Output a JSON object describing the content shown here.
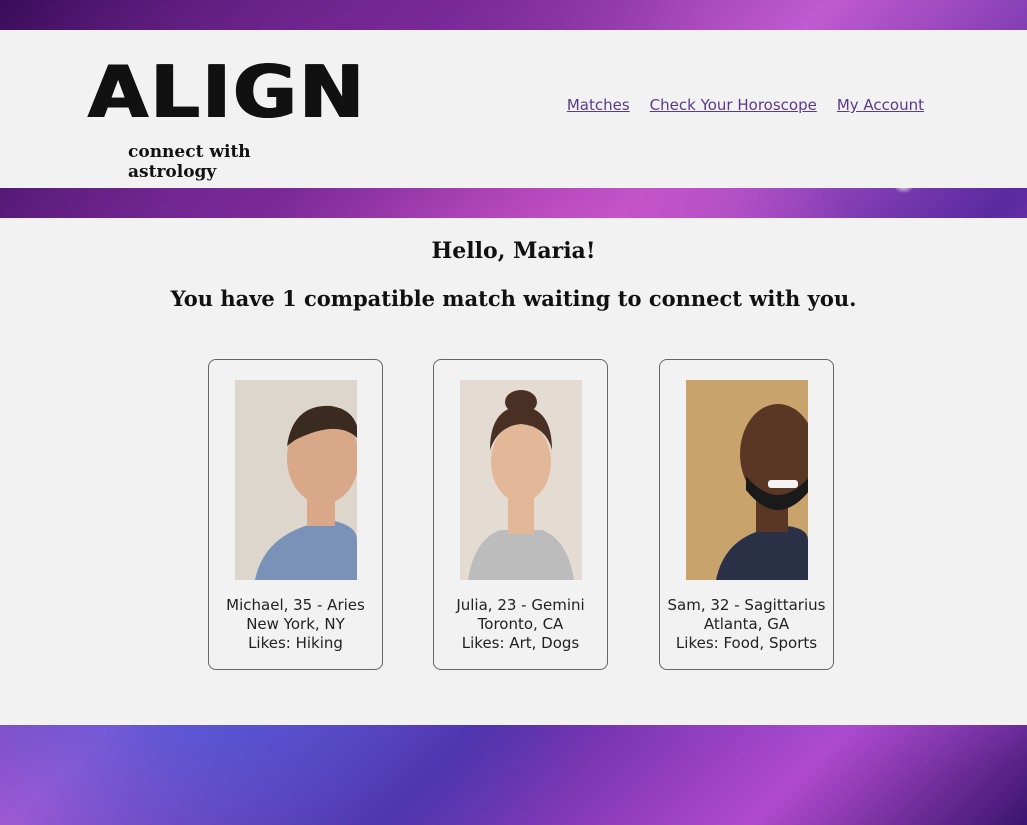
{
  "brand": {
    "logo_text": "ALIGN",
    "tagline": "connect with astrology"
  },
  "nav": {
    "matches": "Matches",
    "horoscope": "Check Your Horoscope",
    "account": "My Account",
    "link_color": "#5a3a8a"
  },
  "main": {
    "greeting": "Hello, Maria!",
    "subline": "You have 1 compatible match waiting to connect with you."
  },
  "matches": [
    {
      "title": "Michael, 35 - Aries",
      "location": "New York, NY",
      "likes": "Likes: Hiking",
      "photo": {
        "bg": "#dcd6cc",
        "skin": "#d8a888",
        "hair": "#3a2a20",
        "shirt": "#7a92b8"
      }
    },
    {
      "title": "Julia, 23 - Gemini",
      "location": "Toronto, CA",
      "likes": "Likes: Art, Dogs",
      "photo": {
        "bg": "#e4dcd2",
        "skin": "#e2b898",
        "hair": "#4a3024",
        "shirt": "#bcbcbc"
      }
    },
    {
      "title": "Sam, 32 - Sagittarius",
      "location": "Atlanta, GA",
      "likes": "Likes: Food, Sports",
      "photo": {
        "bg": "#c8a46c",
        "skin": "#5a3624",
        "hair": "#1a1a1a",
        "shirt": "#2a3046"
      }
    }
  ]
}
